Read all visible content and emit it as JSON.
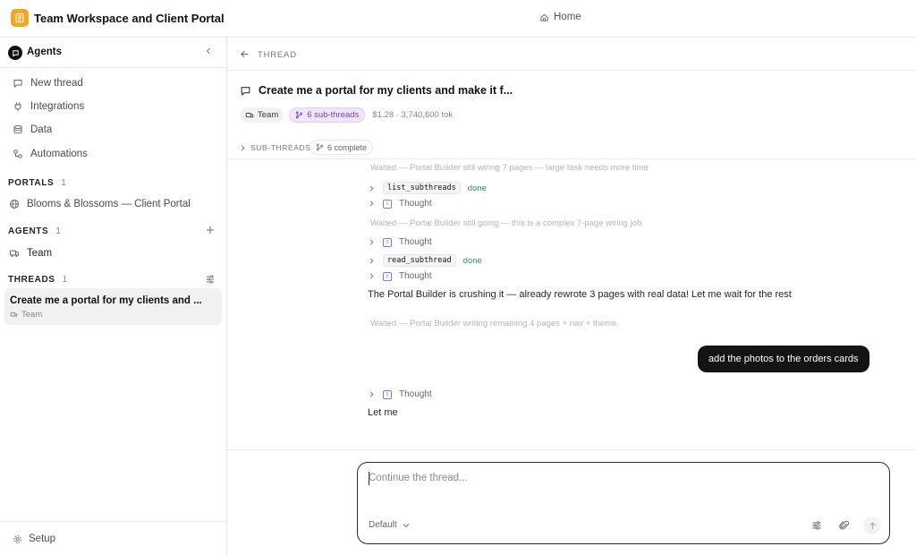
{
  "app": {
    "title": "Team Workspace and Client Portal",
    "home_label": "Home"
  },
  "sidebar": {
    "header_label": "Agents",
    "nav": [
      {
        "label": "New thread",
        "icon": "chat-icon"
      },
      {
        "label": "Integrations",
        "icon": "plug-icon"
      },
      {
        "label": "Data",
        "icon": "database-icon"
      },
      {
        "label": "Automations",
        "icon": "workflow-icon"
      }
    ],
    "portals": {
      "title": "PORTALS",
      "count": "1",
      "items": [
        {
          "label": "Blooms & Blossoms — Client Portal",
          "icon": "globe-icon"
        }
      ]
    },
    "agents": {
      "title": "AGENTS",
      "count": "1",
      "items": [
        {
          "label": "Team",
          "icon": "team-icon"
        }
      ]
    },
    "threads": {
      "title": "THREADS",
      "count": "1",
      "items": [
        {
          "title": "Create me a portal for my clients and ...",
          "agent": "Team"
        }
      ]
    },
    "setup_label": "Setup"
  },
  "thread": {
    "breadcrumb": "THREAD",
    "title": "Create me a portal for my clients and make it f...",
    "agent_chip": "Team",
    "subthreads_chip": "6 sub-threads",
    "cost": "$1.28 · 3,740,600 tok",
    "subthreads_label": "SUB-THREADS",
    "subthreads_complete": "6 complete"
  },
  "messages": {
    "waited_1": "Waited — Portal Builder still wiring 7 pages — large task needs more time",
    "tool_1": "list_subthreads",
    "tool_1_status": "done",
    "thought_label": "Thought",
    "waited_2": "Waited — Portal Builder still going — this is a complex 7-page wiring job",
    "tool_2": "read_subthread",
    "tool_2_status": "done",
    "assistant_1": "The Portal Builder is crushing it — already rewrote 3 pages with real data! Let me wait for the rest",
    "waited_3": "Waited — Portal Builder writing remaining 4 pages + nav + theme.",
    "user_1": "add the photos to the orders cards",
    "assistant_2": "Let me"
  },
  "composer": {
    "placeholder": "Continue the thread...",
    "model": "Default"
  }
}
